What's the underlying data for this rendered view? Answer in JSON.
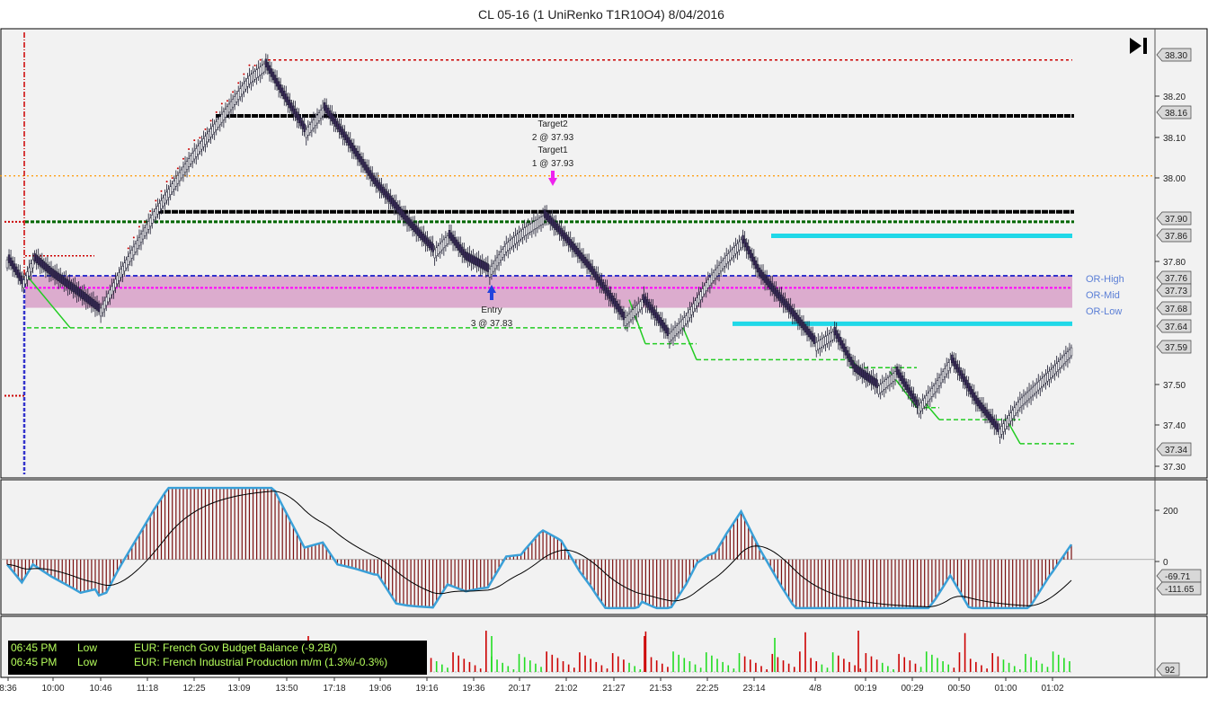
{
  "header": {
    "title": "CL 05-16 (1 UniRenko T1R10O4)  8/04/2016"
  },
  "colors": {
    "bar_up": "#ffffff",
    "bar_down": "#3a2a5a",
    "bar_outline": "#1a1a2e",
    "renko_up_dots": "#cc0000",
    "trail_green": "#22cc22",
    "or_band": "#d8a0c8",
    "or_line": "#3333cc",
    "or_mid": "#ff00ff",
    "cyan": "#20d8e8",
    "target_line": "#000000",
    "dkgreen": "#006600",
    "orange": "#ff9900",
    "macd_hist": "#7a1010",
    "macd_line": "#3aa0d8",
    "signal_line": "#000000",
    "vol_up": "#22dd22",
    "vol_down": "#cc0000",
    "news_text": "#b6ff5c"
  },
  "chart_data": {
    "type": "candlestick",
    "title": "CL 05-16 (1 UniRenko T1R10O4)  8/04/2016",
    "panels": [
      {
        "name": "price",
        "ylim": [
          37.27,
          38.36
        ],
        "y_ticks": [
          "38.20",
          "38.10",
          "38.00",
          "37.80",
          "37.50",
          "37.40",
          "37.30"
        ],
        "price_markers": [
          "38.30",
          "38.16",
          "37.90",
          "37.86",
          "37.76",
          "37.73",
          "37.68",
          "37.64",
          "37.59",
          "37.34"
        ],
        "levels": [
          {
            "label": "OR-High",
            "value": 37.76
          },
          {
            "label": "OR-Mid",
            "value": 37.73
          },
          {
            "label": "OR-Low",
            "value": 37.68
          }
        ],
        "annotations": [
          {
            "label": "Target2",
            "detail": "2 @ 37.93"
          },
          {
            "label": "Target1",
            "detail": "1 @ 37.93"
          },
          {
            "label": "Entry",
            "detail": "3 @ 37.83"
          }
        ],
        "close_path": [
          [
            0,
            37.8
          ],
          [
            8,
            37.74
          ],
          [
            14,
            37.8
          ],
          [
            24,
            37.76
          ],
          [
            36,
            37.72
          ],
          [
            50,
            37.67
          ],
          [
            60,
            37.76
          ],
          [
            80,
            37.92
          ],
          [
            100,
            38.06
          ],
          [
            118,
            38.17
          ],
          [
            132,
            38.26
          ],
          [
            140,
            38.29
          ],
          [
            150,
            38.21
          ],
          [
            162,
            38.12
          ],
          [
            172,
            38.18
          ],
          [
            184,
            38.1
          ],
          [
            200,
            37.99
          ],
          [
            218,
            37.89
          ],
          [
            232,
            37.82
          ],
          [
            240,
            37.86
          ],
          [
            250,
            37.8
          ],
          [
            262,
            37.77
          ],
          [
            272,
            37.84
          ],
          [
            282,
            37.88
          ],
          [
            292,
            37.91
          ],
          [
            300,
            37.87
          ],
          [
            318,
            37.77
          ],
          [
            336,
            37.65
          ],
          [
            346,
            37.7
          ],
          [
            360,
            37.61
          ],
          [
            370,
            37.66
          ],
          [
            382,
            37.75
          ],
          [
            392,
            37.81
          ],
          [
            400,
            37.85
          ],
          [
            410,
            37.76
          ],
          [
            426,
            37.67
          ],
          [
            440,
            37.59
          ],
          [
            450,
            37.62
          ],
          [
            462,
            37.52
          ],
          [
            474,
            37.48
          ],
          [
            484,
            37.52
          ],
          [
            496,
            37.43
          ],
          [
            506,
            37.49
          ],
          [
            514,
            37.55
          ],
          [
            528,
            37.44
          ],
          [
            540,
            37.37
          ],
          [
            552,
            37.45
          ],
          [
            570,
            37.53
          ],
          [
            580,
            37.58
          ]
        ]
      },
      {
        "name": "macd",
        "ylim": [
          -180,
          260
        ],
        "y_ticks": [
          "200",
          "0"
        ],
        "value_markers": [
          "-69.71",
          "-111.65"
        ]
      },
      {
        "name": "volume",
        "value_markers": [
          "92"
        ]
      }
    ],
    "x_tick_labels": [
      "8:36",
      "10:00",
      "10:46",
      "11:18",
      "12:25",
      "13:09",
      "13:50",
      "17:18",
      "19:06",
      "19:16",
      "19:36",
      "20:17",
      "21:02",
      "21:27",
      "21:53",
      "22:25",
      "23:14",
      "4/8",
      "00:19",
      "00:29",
      "00:50",
      "01:00",
      "01:02"
    ]
  },
  "news": [
    {
      "time": "06:45 PM",
      "impact": "Low",
      "event": "EUR: French Gov Budget Balance (-9.2B/)"
    },
    {
      "time": "06:45 PM",
      "impact": "Low",
      "event": "EUR: French Industrial Production m/m (1.3%/-0.3%)"
    }
  ]
}
